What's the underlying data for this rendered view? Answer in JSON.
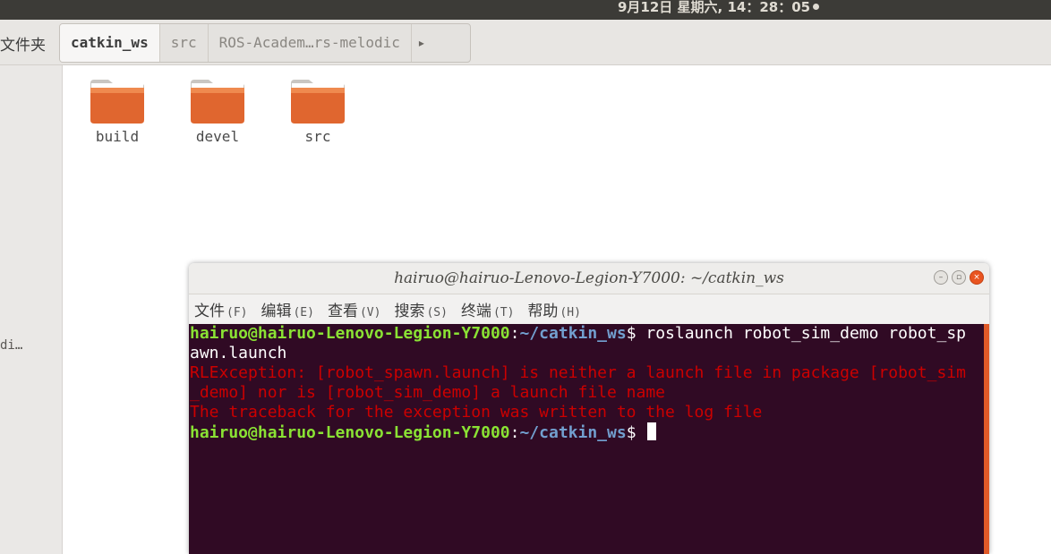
{
  "topbar": {
    "clock": "9月12日 星期六, 14：28：05"
  },
  "file_manager": {
    "back_label": "文件夹",
    "breadcrumbs": [
      {
        "label": "catkin_ws",
        "active": true
      },
      {
        "label": "src",
        "active": false
      },
      {
        "label": "ROS-Academ…rs-melodic",
        "active": false
      }
    ],
    "sidebar_truncated_label": "di…",
    "files": [
      {
        "name": "build",
        "icon": "folder-icon"
      },
      {
        "name": "devel",
        "icon": "folder-icon"
      },
      {
        "name": "src",
        "icon": "folder-icon"
      }
    ]
  },
  "terminal": {
    "title": "hairuo@hairuo-Lenovo-Legion-Y7000: ~/catkin_ws",
    "menu": [
      {
        "label": "文件",
        "accel": "(F)"
      },
      {
        "label": "编辑",
        "accel": "(E)"
      },
      {
        "label": "查看",
        "accel": "(V)"
      },
      {
        "label": "搜索",
        "accel": "(S)"
      },
      {
        "label": "终端",
        "accel": "(T)"
      },
      {
        "label": "帮助",
        "accel": "(H)"
      }
    ],
    "prompt_user": "hairuo@hairuo-Lenovo-Legion-Y7000",
    "prompt_sep": ":",
    "prompt_path": "~/catkin_ws",
    "prompt_symbol": "$",
    "command_line1": " roslaunch robot_sim_demo robot_sp",
    "command_line2": "awn.launch",
    "error_line1": "RLException: [robot_spawn.launch] is neither a launch file in package [robot_sim",
    "error_line2": "_demo] nor is [robot_sim_demo] a launch file name",
    "error_line3": "The traceback for the exception was written to the log file",
    "colors": {
      "background": "#300a24",
      "user": "#8ae234",
      "path": "#729fcf",
      "error": "#cc0000"
    }
  }
}
